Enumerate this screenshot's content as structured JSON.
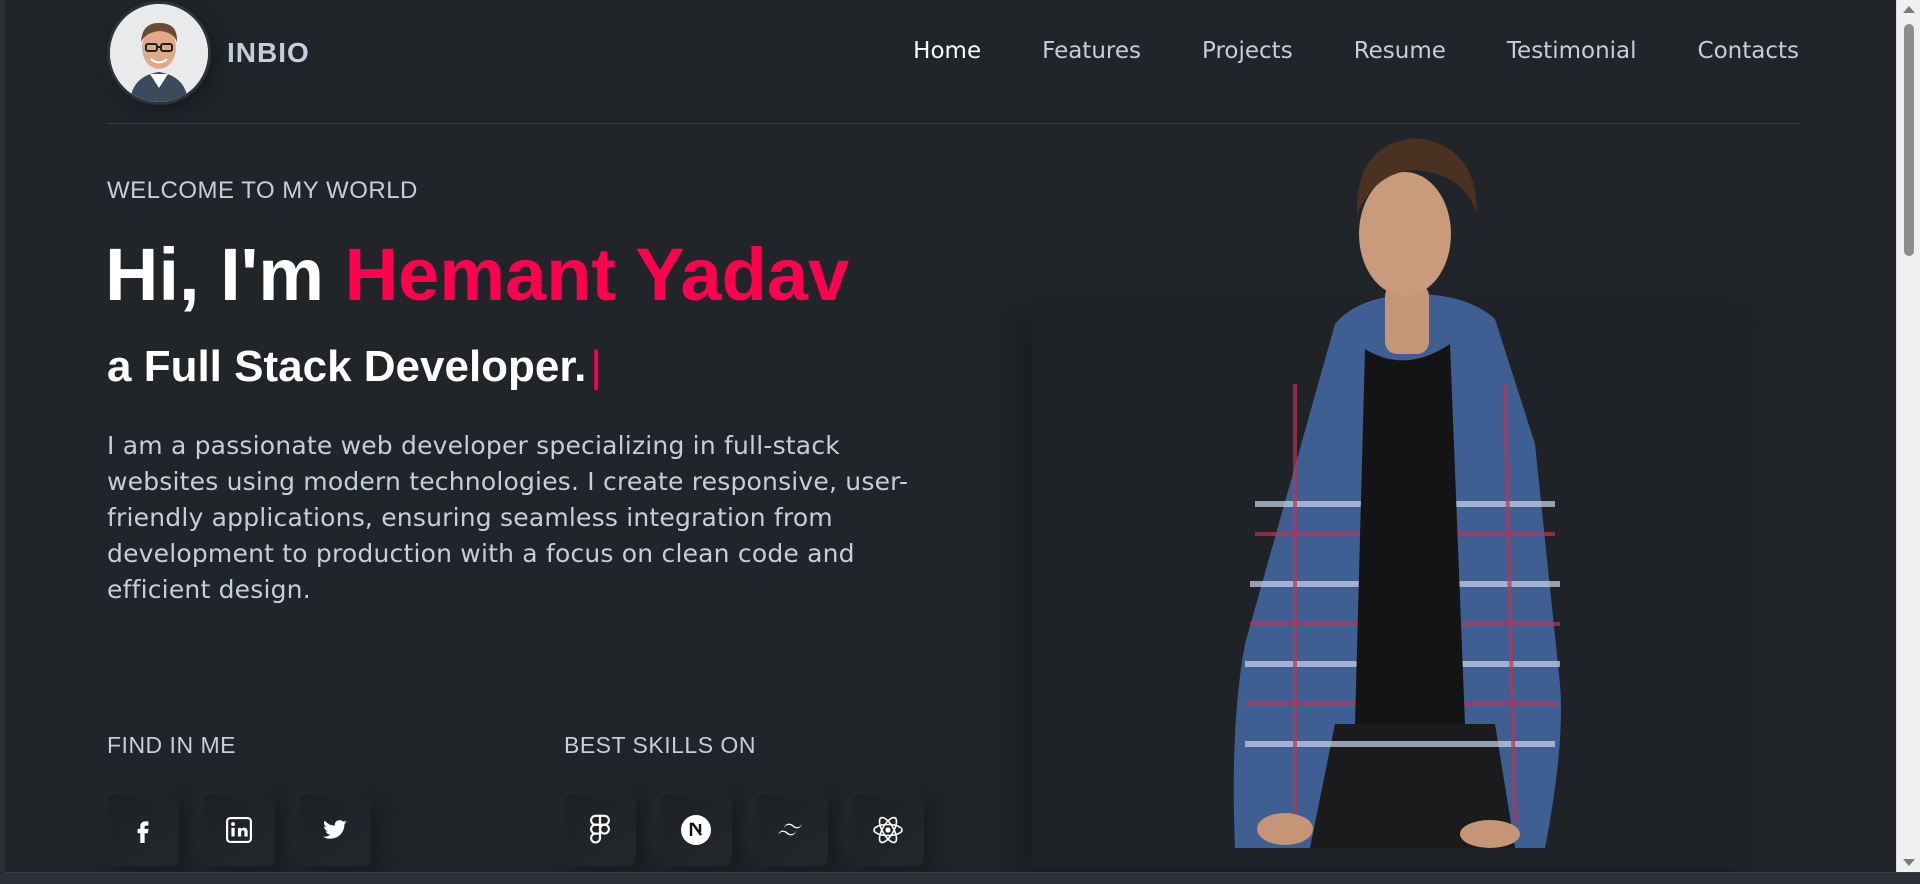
{
  "header": {
    "brand": "INBIO",
    "nav": [
      "Home",
      "Features",
      "Projects",
      "Resume",
      "Testimonial",
      "Contacts"
    ],
    "active_nav": "Home"
  },
  "hero": {
    "welcome": "WELCOME TO MY WORLD",
    "greeting": "Hi, I'm",
    "name": "Hemant Yadav",
    "role": "a Full Stack Developer.",
    "cursor": "|",
    "description": "I am a passionate web developer specializing in full-stack websites using modern technologies. I create responsive, user-friendly applications, ensuring seamless integration from development to production with a focus on clean code and efficient design."
  },
  "find_me": {
    "title": "FIND IN ME",
    "icons": [
      "facebook-icon",
      "linkedin-icon",
      "twitter-icon"
    ]
  },
  "skills": {
    "title": "BEST SKILLS ON",
    "icons": [
      "figma-icon",
      "nextjs-icon",
      "tailwind-icon",
      "react-icon"
    ]
  },
  "colors": {
    "background": "#212428",
    "accent": "#ff014f",
    "text": "#c4cfde",
    "heading": "#ffffff"
  }
}
